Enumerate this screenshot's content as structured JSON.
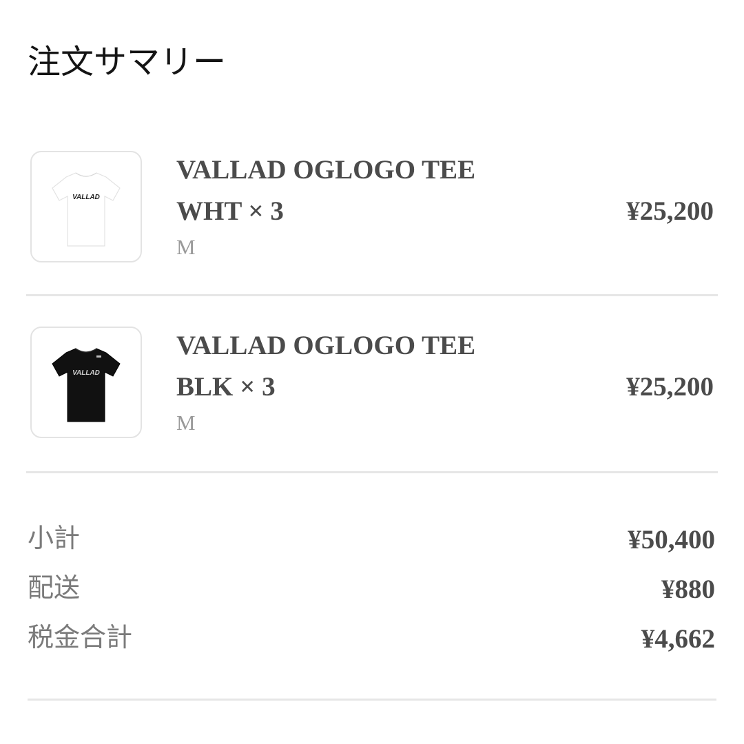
{
  "summary": {
    "title": "注文サマリー"
  },
  "items": [
    {
      "name": "VALLAD OGLOGO TEE",
      "variant": "WHT × 3",
      "size": "M",
      "price": "¥25,200",
      "thumbnail_icon": "white-tshirt-icon",
      "thumbnail_logo": "VALLAD"
    },
    {
      "name": "VALLAD OGLOGO TEE",
      "variant": "BLK × 3",
      "size": "M",
      "price": "¥25,200",
      "thumbnail_icon": "black-tshirt-icon",
      "thumbnail_logo": "VALLAD"
    }
  ],
  "totals": {
    "subtotal": {
      "label": "小計",
      "value": "¥50,400"
    },
    "shipping": {
      "label": "配送",
      "value": "¥880"
    },
    "tax": {
      "label": "税金合計",
      "value": "¥4,662"
    }
  },
  "colors": {
    "text_dark": "#4b4b4b",
    "text_muted": "#9a9a9a",
    "label_gray": "#7a7a7a",
    "divider": "#e6e6e6",
    "thumb_border": "#e3e3e3"
  }
}
